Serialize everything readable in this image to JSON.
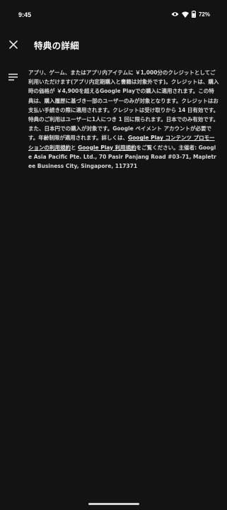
{
  "status_bar": {
    "time": "9:45",
    "battery": "72%",
    "icons": [
      "eye-icon",
      "wifi-icon",
      "battery-icon"
    ]
  },
  "header": {
    "title": "特典の詳細",
    "close_icon": "close-icon"
  },
  "details": {
    "icon": "notes-icon",
    "text_1": "アプリ、ゲーム、またはアプリ内アイテムに ￥1,000分のクレジットとしてご利用いただけます(アプリ内定期購入と書籍は対象外です)。クレジットは、購入時の価格が ￥4,900を超えるGoogle Playでの購入に適用されます。この特典は、購入履歴に基づき一部のユーザーのみが対象となります。クレジットはお支払い手続きの際に適用されます。クレジットは受け取りから 14 日有効です。特典のご利用はユーザーに1人につき 1 回に限られます。日本でのみ有効です。また、日本円での購入が対象です。Google ペイメント アカウントが必要です。年齢制限が適用されます。詳しくは、",
    "link_1": "Google Play コンテンツ プロモーションの利用規約",
    "text_2": "と ",
    "link_2": "Google Play 利用規約",
    "text_3": "をご覧ください。主催者: Google Asia Pacific Pte. Ltd., 70 Pasir Panjang Road #03-71, Mapletree Business City, Singapore, 117371"
  },
  "colors": {
    "background": "#131313",
    "text": "#d9d9d9",
    "title": "#ffffff"
  }
}
